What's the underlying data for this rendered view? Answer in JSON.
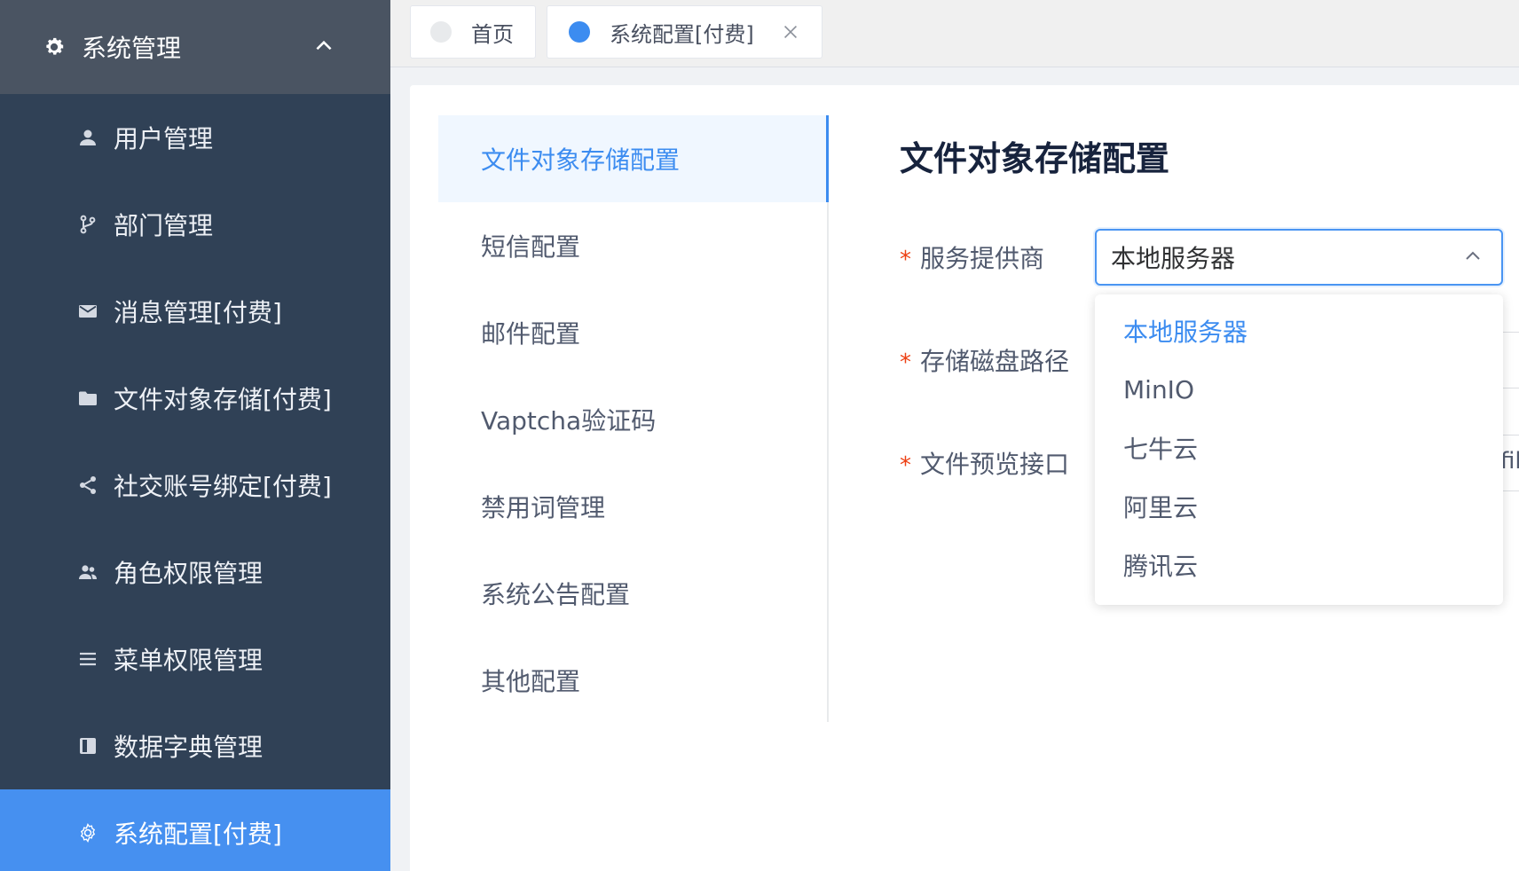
{
  "sidebar": {
    "group": {
      "label": "系统管理",
      "icon": "gear-icon",
      "expanded": true
    },
    "items": [
      {
        "label": "用户管理",
        "icon": "user-icon"
      },
      {
        "label": "部门管理",
        "icon": "branch-icon"
      },
      {
        "label": "消息管理[付费]",
        "icon": "mail-icon"
      },
      {
        "label": "文件对象存储[付费]",
        "icon": "folder-icon"
      },
      {
        "label": "社交账号绑定[付费]",
        "icon": "share-icon"
      },
      {
        "label": "角色权限管理",
        "icon": "users-icon"
      },
      {
        "label": "菜单权限管理",
        "icon": "menu-icon"
      },
      {
        "label": "数据字典管理",
        "icon": "book-icon"
      },
      {
        "label": "系统配置[付费]",
        "icon": "settings-icon",
        "active": true
      }
    ],
    "colors": {
      "background": "#304156",
      "group_bg": "#4a5462",
      "active_bg": "#4690f0"
    }
  },
  "tabs": [
    {
      "label": "首页",
      "active": false
    },
    {
      "label": "系统配置[付费]",
      "active": true,
      "closable": true
    }
  ],
  "submenu": {
    "items": [
      {
        "label": "文件对象存储配置",
        "active": true
      },
      {
        "label": "短信配置"
      },
      {
        "label": "邮件配置"
      },
      {
        "label": "Vaptcha验证码"
      },
      {
        "label": "禁用词管理"
      },
      {
        "label": "系统公告配置"
      },
      {
        "label": "其他配置"
      }
    ]
  },
  "form": {
    "title": "文件对象存储配置",
    "required_mark": "*",
    "fields": [
      {
        "label": "服务提供商"
      },
      {
        "label": "存储磁盘路径"
      },
      {
        "label": "文件预览接口"
      }
    ],
    "provider_select": {
      "value": "本地服务器",
      "open": true,
      "options": [
        "本地服务器",
        "MinIO",
        "七牛云",
        "阿里云",
        "腾讯云"
      ],
      "selected_index": 0
    },
    "preview_value_fragment": "fil"
  },
  "colors": {
    "accent": "#3c8cf0",
    "required": "#ed4014"
  }
}
